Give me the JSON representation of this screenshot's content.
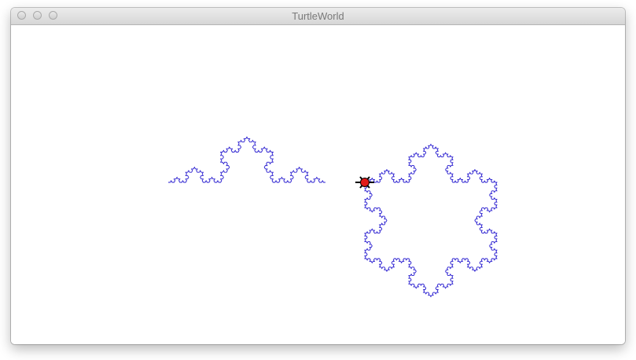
{
  "window": {
    "title": "TurtleWorld"
  },
  "titlebar_buttons": [
    "close",
    "minimize",
    "zoom"
  ],
  "drawing": {
    "line_color": "#2a1fd0",
    "turtle_body_color": "#e11a1a",
    "turtle_outline_color": "#000000",
    "figures": [
      "koch-curve",
      "koch-snowflake"
    ]
  }
}
